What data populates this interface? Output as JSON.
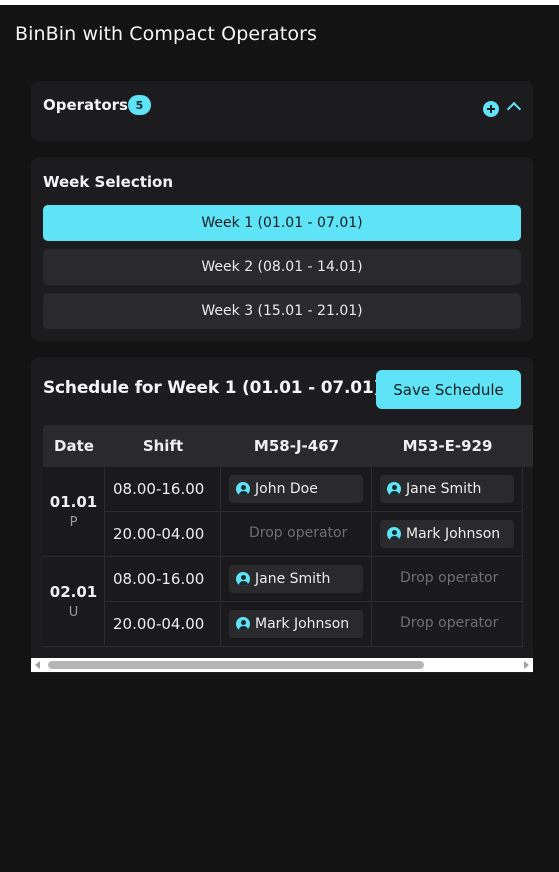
{
  "app": {
    "title": "BinBin with Compact Operators"
  },
  "operators": {
    "label": "Operators",
    "count": "5"
  },
  "week_selection": {
    "title": "Week Selection",
    "weeks": [
      {
        "label": "Week 1 (01.01 - 07.01)",
        "selected": true
      },
      {
        "label": "Week 2 (08.01 - 14.01)",
        "selected": false
      },
      {
        "label": "Week 3 (15.01 - 21.01)",
        "selected": false
      }
    ]
  },
  "schedule": {
    "title": "Schedule for Week 1 (01.01 - 07.01)",
    "save_label": "Save Schedule",
    "columns": [
      "Date",
      "Shift",
      "M58-J-467",
      "M53-E-929"
    ],
    "days": [
      {
        "date": "01.01",
        "day_code": "P",
        "shifts": [
          {
            "time": "08.00-16.00",
            "cells": [
              "John Doe",
              "Jane Smith"
            ]
          },
          {
            "time": "20.00-04.00",
            "cells": [
              "Drop operator",
              "Mark Johnson"
            ]
          }
        ]
      },
      {
        "date": "02.01",
        "day_code": "U",
        "shifts": [
          {
            "time": "08.00-16.00",
            "cells": [
              "Jane Smith",
              "Drop operator"
            ]
          },
          {
            "time": "20.00-04.00",
            "cells": [
              "Mark Johnson",
              "Drop operator"
            ]
          }
        ]
      }
    ]
  },
  "colors": {
    "accent": "#5fe3f6",
    "background": "#131314",
    "card": "#1c1c1e"
  }
}
